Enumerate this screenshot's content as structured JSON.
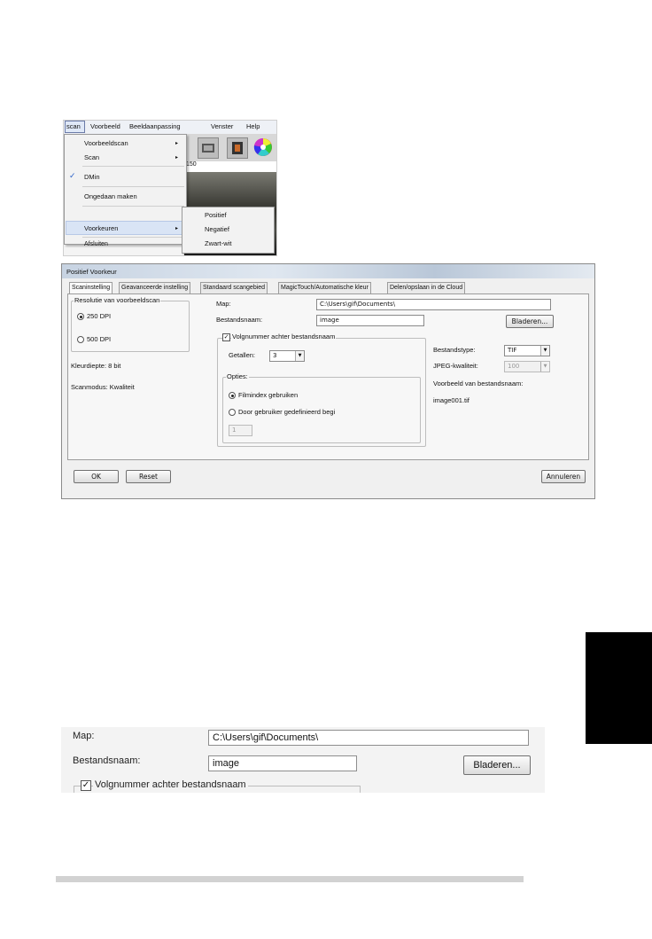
{
  "menu": {
    "bar": [
      "scan",
      "Voorbeeld",
      "Beeldaanpassing",
      "Venster",
      "Help"
    ],
    "items": [
      {
        "label": "Voorbeeldscan",
        "submenu": true
      },
      {
        "label": "Scan",
        "submenu": true
      },
      {
        "label": "DMin",
        "checked": true
      },
      {
        "label": "Ongedaan maken"
      },
      {
        "label": "Voorkeuren",
        "submenu": true
      },
      {
        "label": "Afsluiten"
      }
    ],
    "submenu_items": [
      "Positief",
      "Negatief",
      "Zwart-wit"
    ],
    "ruler_value": "150",
    "check_mark": "✓",
    "arrow": "▸"
  },
  "dialog": {
    "title": "Positief Voorkeur",
    "tabs": [
      "Scaninstelling",
      "Geavanceerde instelling",
      "Standaard scangebied",
      "MagicTouch/Automatische kleur",
      "Delen/opslaan in de Cloud"
    ],
    "resolution_group": "Resolutie van voorbeeldscan",
    "res_250": "250 DPI",
    "res_500": "500 DPI",
    "color_depth": "Kleurdiepte: 8 bit",
    "scan_mode": "Scanmodus: Kwaliteit",
    "map_label": "Map:",
    "map_value": "C:\\Users\\gif\\Documents\\",
    "filename_label": "Bestandsnaam:",
    "filename_value": "image",
    "browse": "Bladeren...",
    "seq_label": "Volgnummer achter bestandsnaam",
    "digits_label": "Getallen:",
    "digits_value": "3",
    "options_group": "Opties:",
    "opt_film_index": "Filmindex gebruiken",
    "opt_user_defined": "Door gebruiker gedefinieerd begi",
    "start_value": "1",
    "filetype_label": "Bestandstype:",
    "filetype_value": "TIF",
    "jpeg_label": "JPEG-kwaliteit:",
    "jpeg_value": "100",
    "example_label": "Voorbeeld van bestandsnaam:",
    "example_value": "image001.tif",
    "ok": "OK",
    "reset": "Reset",
    "cancel": "Annuleren"
  },
  "zoom": {
    "map_label": "Map:",
    "map_value": "C:\\Users\\gif\\Documents\\",
    "filename_label": "Bestandsnaam:",
    "filename_value": "image",
    "browse": "Bladeren...",
    "seq_label": "Volgnummer achter bestandsnaam"
  }
}
